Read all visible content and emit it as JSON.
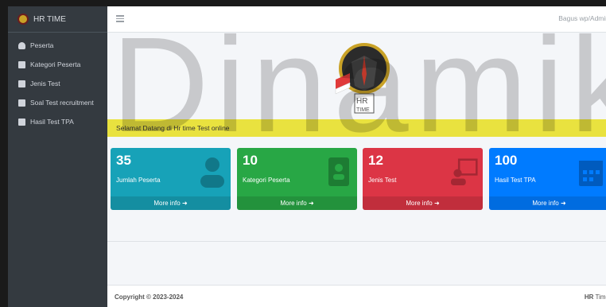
{
  "brand": {
    "title": "HR TIME"
  },
  "sidebar": {
    "items": [
      {
        "label": "Peserta",
        "icon": "user-icon"
      },
      {
        "label": "Kategori Peserta",
        "icon": "address-book-icon"
      },
      {
        "label": "Jenis Test",
        "icon": "chalkboard-icon"
      },
      {
        "label": "Soal Test recruitment",
        "icon": "file-icon"
      },
      {
        "label": "Hasil Test TPA",
        "icon": "calendar-icon"
      }
    ]
  },
  "header": {
    "user": "Bagus wp/Admin"
  },
  "logo": {
    "text_top": "HR",
    "text_bottom": "TIME"
  },
  "welcome": "Selamat Datang di Hr time Test online",
  "cards": [
    {
      "value": "35",
      "label": "Jumlah Peserta",
      "link": "More info",
      "color": "#17a2b8"
    },
    {
      "value": "10",
      "label": "Kategori Peserta",
      "link": "More info",
      "color": "#28a745"
    },
    {
      "value": "12",
      "label": "Jenis Test",
      "link": "More info",
      "color": "#dc3545"
    },
    {
      "value": "100",
      "label": "Hasil Test TPA",
      "link": "More info",
      "color": "#007bff"
    }
  ],
  "footer": {
    "copyright": "Copyright © 2023-2024",
    "brand_bold": "HR",
    "brand_rest": " Time"
  },
  "watermark": {
    "text": "Dinamika"
  }
}
